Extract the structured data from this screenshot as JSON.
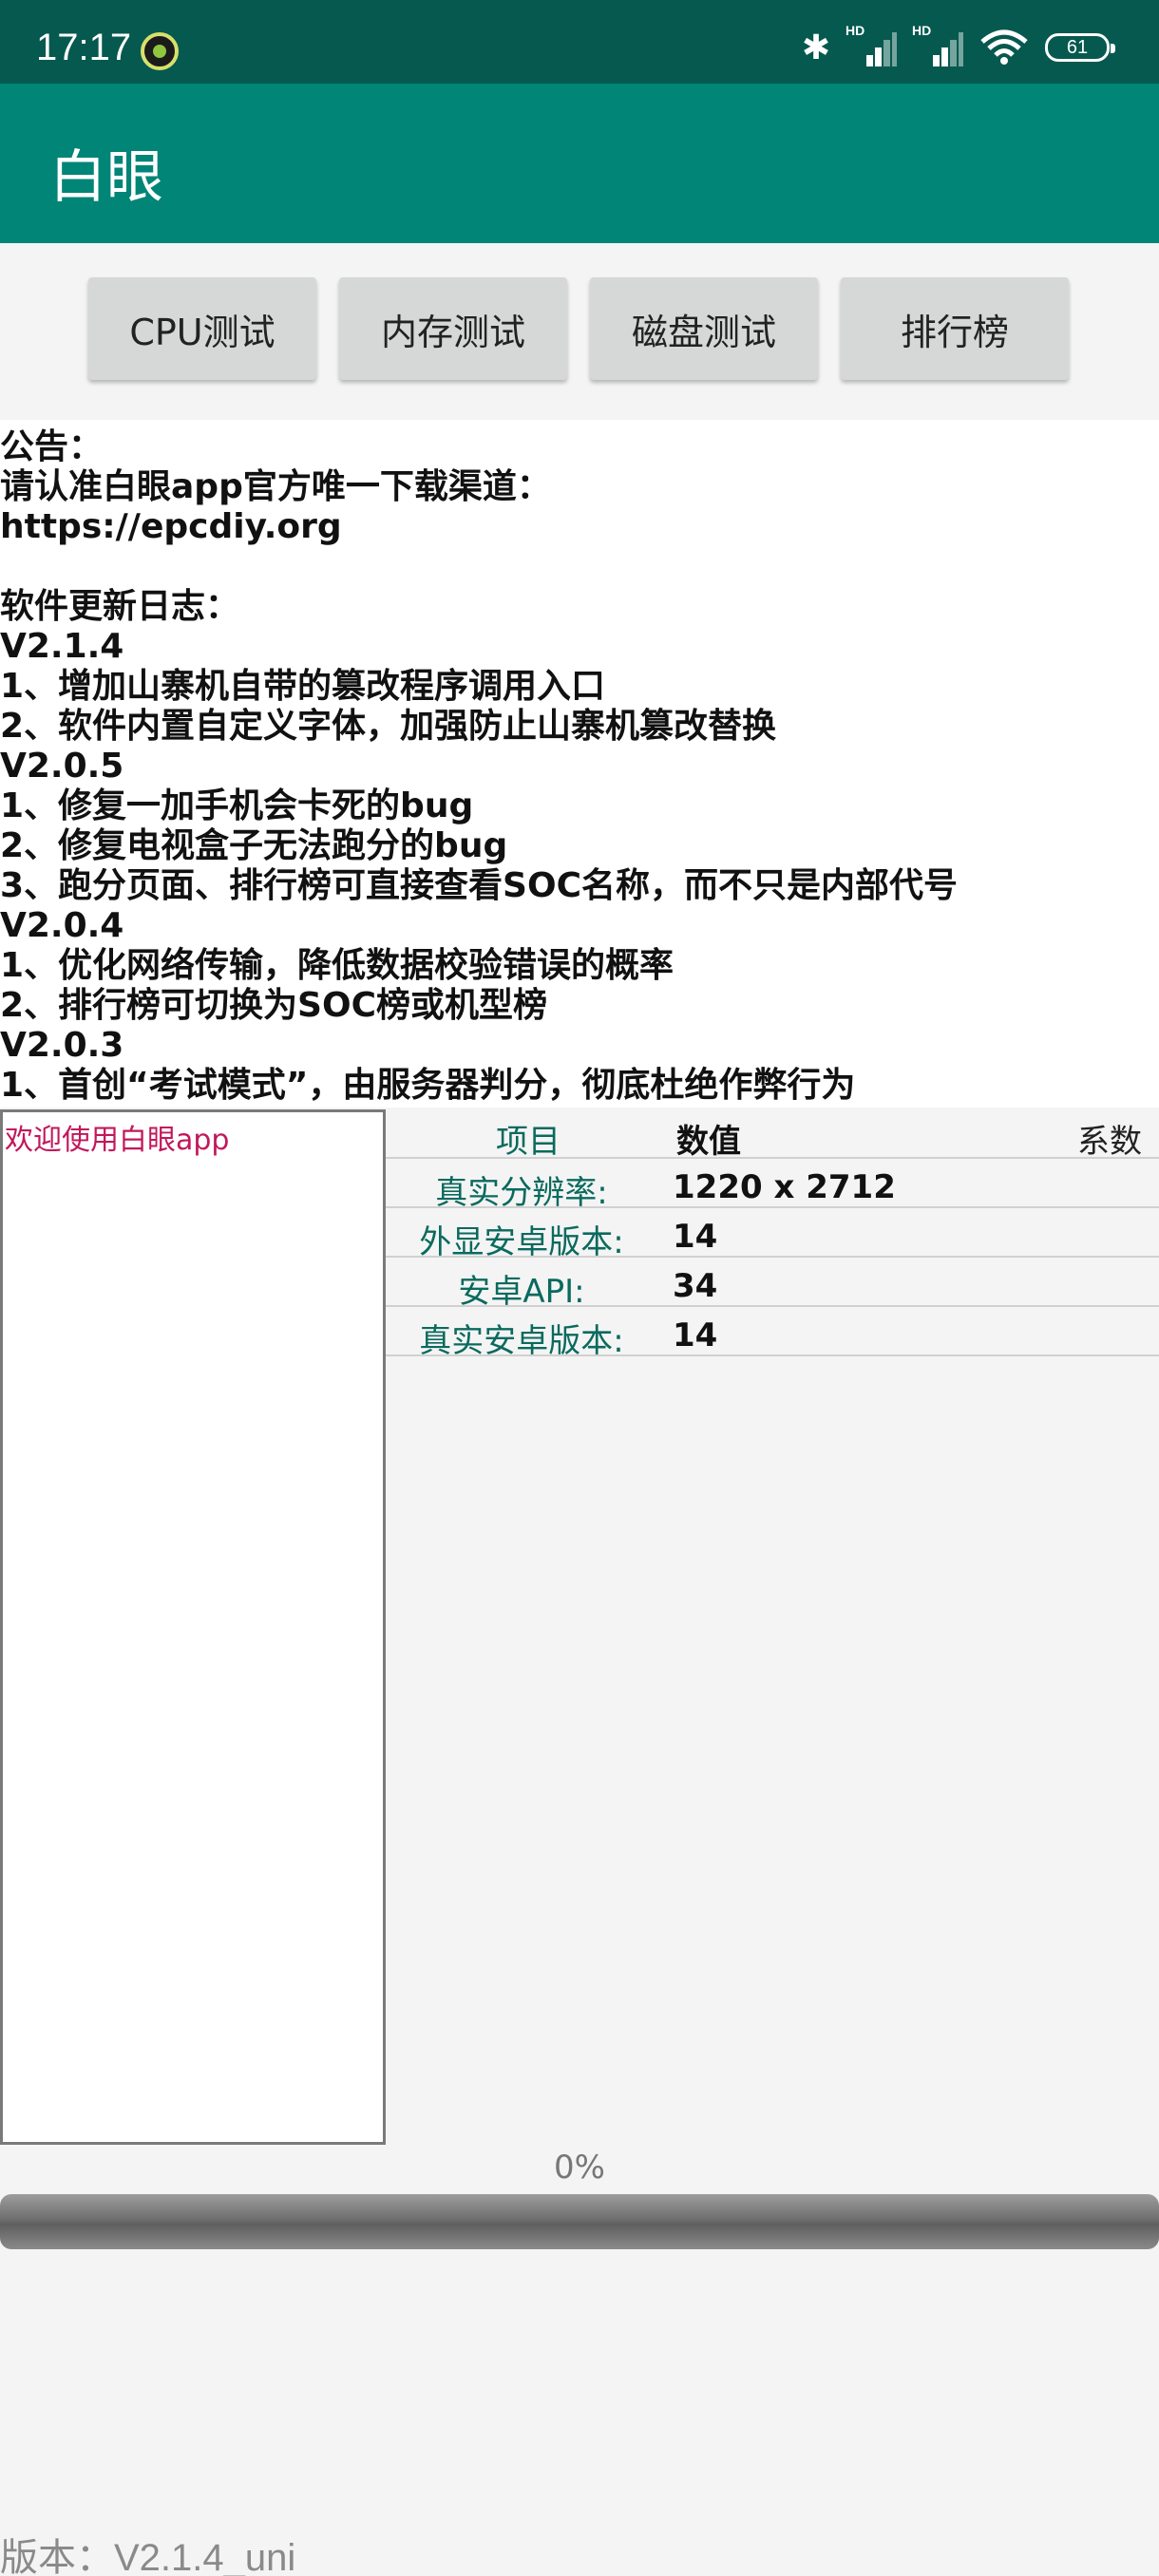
{
  "status_bar": {
    "time": "17:17",
    "battery": "61",
    "icons": [
      "notification-app-icon",
      "bluetooth-icon",
      "signal-hd-icon",
      "signal-hd-icon",
      "wifi-icon",
      "battery-icon"
    ]
  },
  "app_bar": {
    "title": "白眼"
  },
  "buttons": {
    "cpu": "CPU测试",
    "memory": "内存测试",
    "disk": "磁盘测试",
    "ranking": "排行榜"
  },
  "notice_lines": [
    "公告：",
    "请认准白眼app官方唯一下载渠道：",
    "https://epcdiy.org",
    "",
    "软件更新日志：",
    "V2.1.4",
    "1、增加山寨机自带的篡改程序调用入口",
    "2、软件内置自定义字体，加强防止山寨机篡改替换",
    "V2.0.5",
    "1、修复一加手机会卡死的bug",
    "2、修复电视盒子无法跑分的bug",
    "3、跑分页面、排行榜可直接查看SOC名称，而不只是内部代号",
    "V2.0.4",
    "1、优化网络传输，降低数据校验错误的概率",
    "2、排行榜可切换为SOC榜或机型榜",
    "V2.0.3",
    "1、首创“考试模式”，由服务器判分，彻底杜绝作弊行为"
  ],
  "log": {
    "message": "欢迎使用白眼app"
  },
  "table": {
    "headers": {
      "item": "项目",
      "value": "数值",
      "coef": "系数"
    },
    "rows": [
      {
        "key": "真实分辨率:",
        "value": "1220 x 2712"
      },
      {
        "key": "外显安卓版本:",
        "value": "14"
      },
      {
        "key": "安卓API:",
        "value": "34"
      },
      {
        "key": "真实安卓版本:",
        "value": "14"
      }
    ]
  },
  "progress": {
    "label": "0%",
    "fraction": 0
  },
  "footer": {
    "version": "版本：V2.1.4_uni"
  },
  "colors": {
    "status_bar": "#06594f",
    "app_bar": "#008577",
    "accent_text": "#c2185b"
  }
}
